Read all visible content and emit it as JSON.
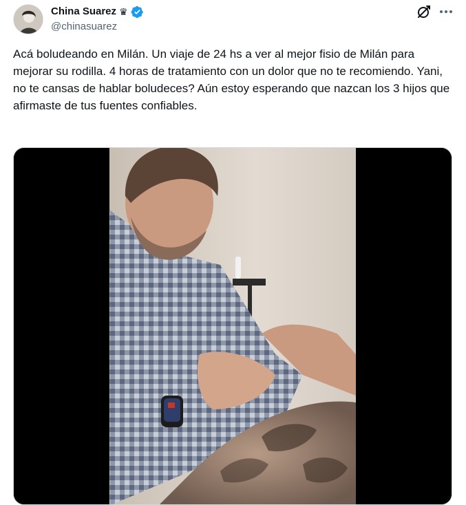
{
  "author": {
    "display_name": "China Suarez",
    "name_emoji": "♛",
    "handle": "@chinasuarez",
    "verified": true,
    "verified_color": "#1d9bf0"
  },
  "tweet": {
    "text": "Acá boludeando en Milán. Un viaje de 24 hs a ver al mejor fisio de Milán para mejorar su rodilla. 4 horas de tratamiento con un dolor que no te recomiendo. Yani, no te cansas de hablar boludeces? Aún estoy esperando que nazcan los 3 hijos que afirmaste de tus fuentes confiables."
  },
  "icons": {
    "avatar": "profile-photo",
    "crown": "crown-icon",
    "verified": "verified-badge-icon",
    "grok": "grok-icon",
    "more": "more-horizontal-icon"
  },
  "media": {
    "type": "video",
    "description_icon": "video-frame"
  },
  "colors": {
    "text_primary": "#0f1419",
    "text_secondary": "#536471",
    "media_background": "#000000"
  }
}
